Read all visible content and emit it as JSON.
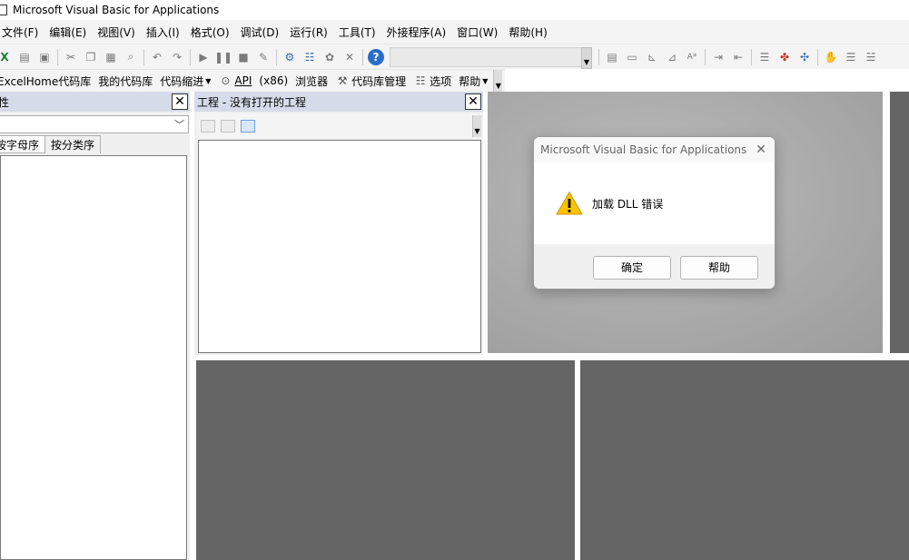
{
  "window": {
    "title": "Microsoft Visual Basic for Applications"
  },
  "menubar": {
    "items": [
      "文件(F)",
      "编辑(E)",
      "视图(V)",
      "插入(I)",
      "格式(O)",
      "调试(D)",
      "运行(R)",
      "工具(T)",
      "外接程序(A)",
      "窗口(W)",
      "帮助(H)"
    ]
  },
  "toolbar_addin": {
    "excelhome": "ExcelHome代码库",
    "my_code": "我的代码库",
    "indent": "代码缩进",
    "api": "API",
    "x86": "(x86)",
    "browser": "浏览器",
    "manage": "代码库管理",
    "options": "选项",
    "help": "帮助"
  },
  "properties_pane": {
    "title": "性",
    "tab_alpha": "按字母序",
    "tab_category": "按分类序"
  },
  "project_pane": {
    "title": "工程 - 没有打开的工程"
  },
  "dialog": {
    "title": "Microsoft Visual Basic for Applications",
    "message": "加载 DLL 错误",
    "ok_label": "确定",
    "help_label": "帮助"
  },
  "colors": {
    "accent": "#0078d4",
    "workspace": "#656565"
  }
}
